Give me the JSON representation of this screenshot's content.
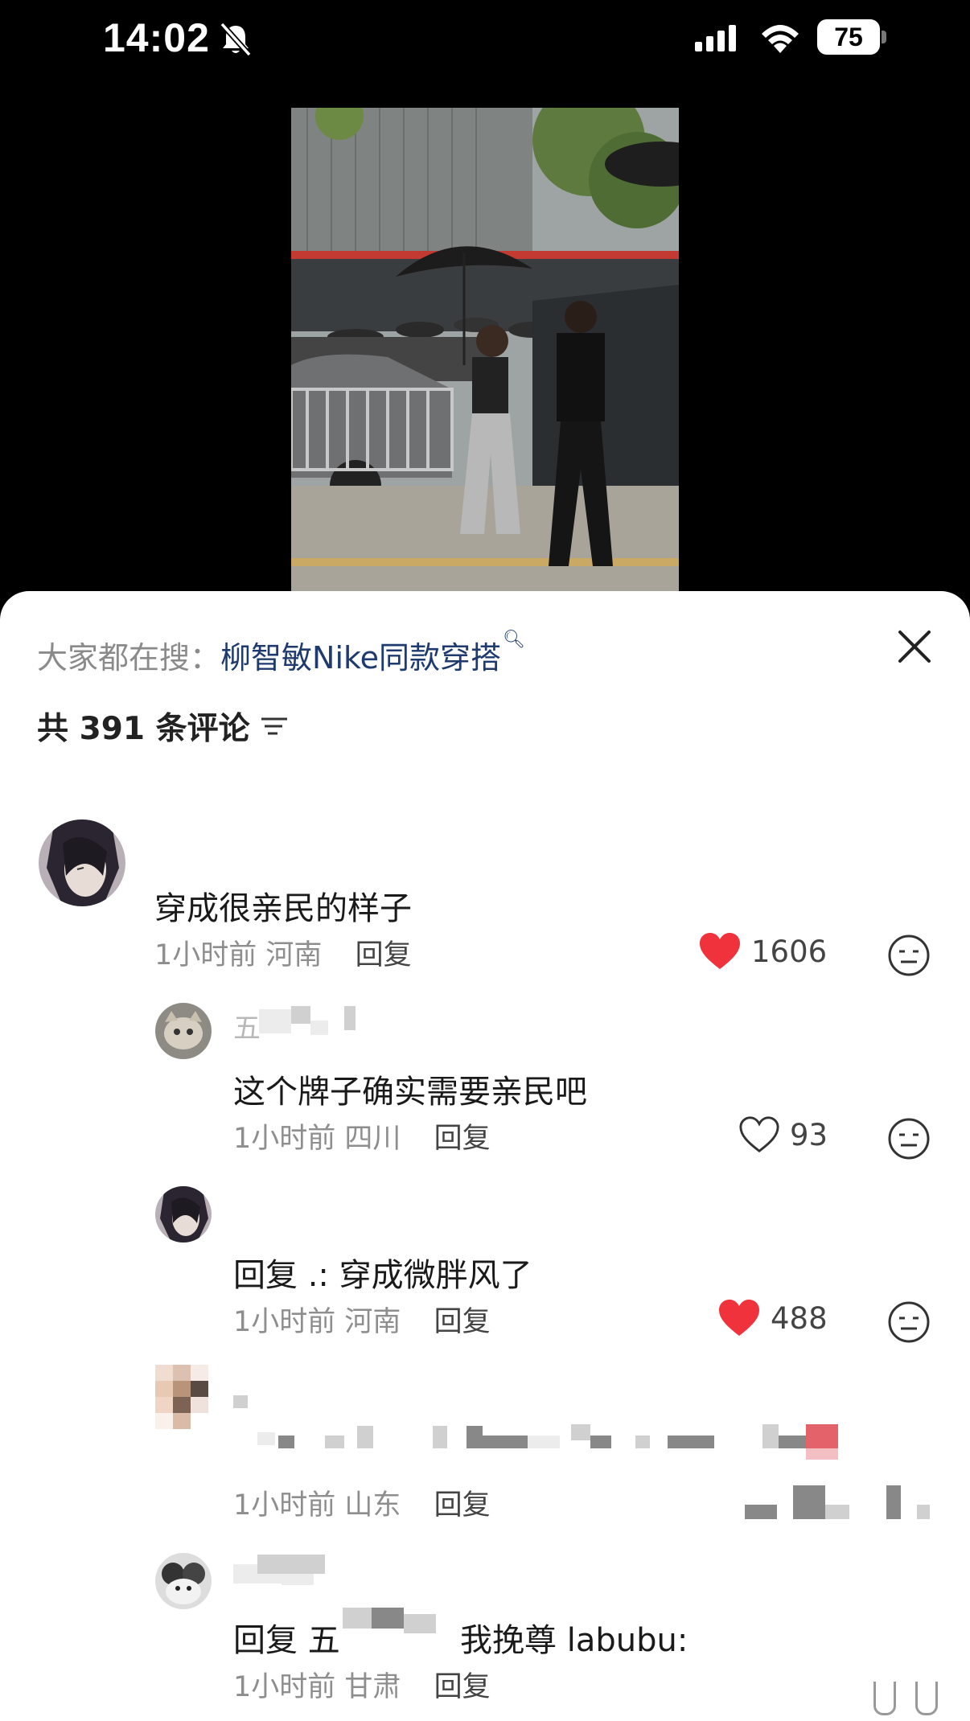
{
  "status_bar": {
    "time": "14:02",
    "battery_level": "75"
  },
  "search_bar": {
    "label": "大家都在搜：",
    "query": "柳智敏Nike同款穿搭"
  },
  "comments_header": {
    "count_text": "共 391 条评论"
  },
  "comments": [
    {
      "text": "穿成很亲民的样子",
      "time": "1小时前",
      "location": "河南",
      "reply_label": "回复",
      "likes": "1606",
      "liked": true
    },
    {
      "name": "五",
      "text": "这个牌子确实需要亲民吧",
      "time": "1小时前",
      "location": "四川",
      "reply_label": "回复",
      "likes": "93",
      "liked": false
    },
    {
      "text": "回复 .: 穿成微胖风了",
      "time": "1小时前",
      "location": "河南",
      "reply_label": "回复",
      "likes": "488",
      "liked": true
    },
    {
      "time": "1小时前",
      "location": "山东",
      "reply_label": "回复"
    },
    {
      "text_prefix": "回复 五",
      "text_suffix": "我挽尊 labubu:",
      "time": "1小时前",
      "location": "甘肃",
      "reply_label": "回复"
    }
  ],
  "colors": {
    "like_red": "#f0323c",
    "link_blue": "#1e3a6e"
  }
}
